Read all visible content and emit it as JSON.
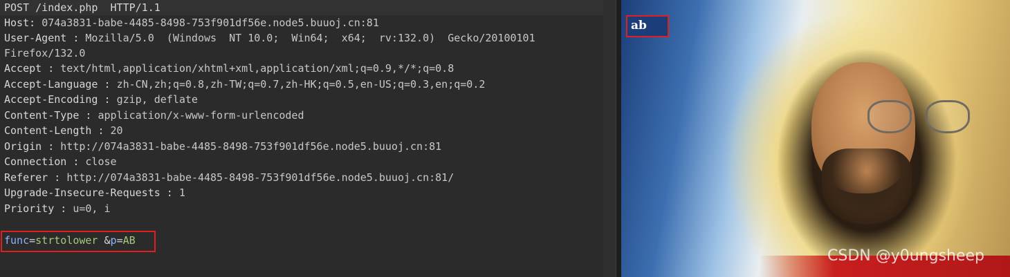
{
  "request": {
    "request_line": "POST /index.php  HTTP/1.1",
    "headers": [
      {
        "name": "Host",
        "value": "074a3831-babe-4485-8498-753f901df56e.node5.buuoj.cn:81"
      },
      {
        "name": "User-Agent",
        "value": "Mozilla/5.0  (Windows  NT 10.0;  Win64;  x64;  rv:132.0)  Gecko/20100101"
      },
      {
        "name": "",
        "value": "Firefox/132.0"
      },
      {
        "name": "Accept",
        "value": "text/html,application/xhtml+xml,application/xml;q=0.9,*/*;q=0.8"
      },
      {
        "name": "Accept-Language",
        "value": "zh-CN,zh;q=0.8,zh-TW;q=0.7,zh-HK;q=0.5,en-US;q=0.3,en;q=0.2"
      },
      {
        "name": "Accept-Encoding",
        "value": "gzip, deflate"
      },
      {
        "name": "Content-Type",
        "value": "application/x-www-form-urlencoded"
      },
      {
        "name": "Content-Length",
        "value": "20"
      },
      {
        "name": "Origin",
        "value": "http://074a3831-babe-4485-8498-753f901df56e.node5.buuoj.cn:81"
      },
      {
        "name": "Connection",
        "value": "close"
      },
      {
        "name": "Referer",
        "value": "http://074a3831-babe-4485-8498-753f901df56e.node5.buuoj.cn:81/"
      },
      {
        "name": "Upgrade-Insecure-Requests",
        "value": "1"
      },
      {
        "name": "Priority",
        "value": "u=0, i"
      }
    ],
    "body": {
      "param1_key": "func",
      "param1_value": "strtolower",
      "param2_key": "p",
      "param2_value": "AB"
    }
  },
  "response": {
    "output": "ab",
    "watermark": "CSDN @y0ungsheep"
  },
  "colors": {
    "param_key": "#8fb3ff",
    "param_value": "#a5c97a",
    "highlight_border": "#e02020"
  }
}
